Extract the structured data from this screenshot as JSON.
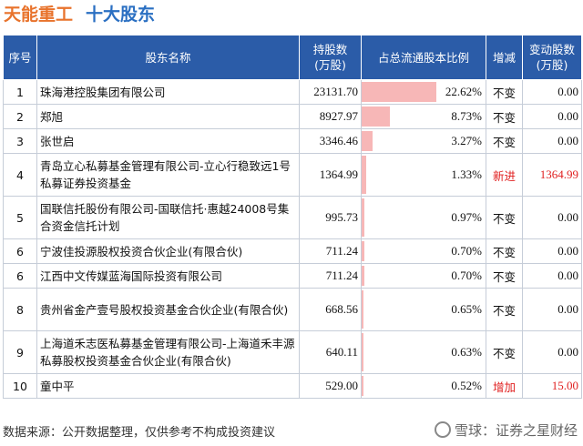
{
  "title": {
    "company": "天能重工",
    "subtitle": "十大股东"
  },
  "headers": {
    "idx": "序号",
    "name": "股东名称",
    "shares": "持股数\n(万股)",
    "ratio": "占总流通股本比例",
    "change": "增减",
    "delta": "变动股数\n(万股)"
  },
  "rows": [
    {
      "idx": "1",
      "name": "珠海港控股集团有限公司",
      "shares": "23131.70",
      "ratio": "22.62%",
      "ratio_value": 22.62,
      "change": "不变",
      "delta": "0.00"
    },
    {
      "idx": "2",
      "name": "郑旭",
      "shares": "8927.97",
      "ratio": "8.73%",
      "ratio_value": 8.73,
      "change": "不变",
      "delta": "0.00"
    },
    {
      "idx": "3",
      "name": "张世启",
      "shares": "3346.46",
      "ratio": "3.27%",
      "ratio_value": 3.27,
      "change": "不变",
      "delta": "0.00"
    },
    {
      "idx": "4",
      "name": "青岛立心私募基金管理有限公司-立心行稳致远1号私募证券投资基金",
      "shares": "1364.99",
      "ratio": "1.33%",
      "ratio_value": 1.33,
      "change": "新进",
      "delta": "1364.99"
    },
    {
      "idx": "5",
      "name": "国联信托股份有限公司-国联信托·惠越24008号集合资金信托计划",
      "shares": "995.73",
      "ratio": "0.97%",
      "ratio_value": 0.97,
      "change": "不变",
      "delta": "0.00"
    },
    {
      "idx": "6",
      "name": "宁波佳投源股权投资合伙企业(有限合伙)",
      "shares": "711.24",
      "ratio": "0.70%",
      "ratio_value": 0.7,
      "change": "不变",
      "delta": "0.00"
    },
    {
      "idx": "6",
      "name": "江西中文传媒蓝海国际投资有限公司",
      "shares": "711.24",
      "ratio": "0.70%",
      "ratio_value": 0.7,
      "change": "不变",
      "delta": "0.00"
    },
    {
      "idx": "8",
      "name": "贵州省金产壹号股权投资基金合伙企业(有限合伙)",
      "shares": "668.56",
      "ratio": "0.65%",
      "ratio_value": 0.65,
      "change": "不变",
      "delta": "0.00"
    },
    {
      "idx": "9",
      "name": "上海道禾志医私募基金管理有限公司-上海道禾丰源私募股权投资基金合伙企业(有限合伙)",
      "shares": "640.11",
      "ratio": "0.63%",
      "ratio_value": 0.63,
      "change": "不变",
      "delta": "0.00"
    },
    {
      "idx": "10",
      "name": "童中平",
      "shares": "529.00",
      "ratio": "0.52%",
      "ratio_value": 0.52,
      "change": "增加",
      "delta": "15.00"
    }
  ],
  "footer": "数据来源：公开数据整理，仅供参考不构成投资建议",
  "brand": "雪球：证券之星财经",
  "colors": {
    "header_bg": "#2b5ca8",
    "bar": "#f7b7b7",
    "highlight": "#e02020",
    "title_company": "#e8732c",
    "title_sub": "#2a6fc2"
  }
}
